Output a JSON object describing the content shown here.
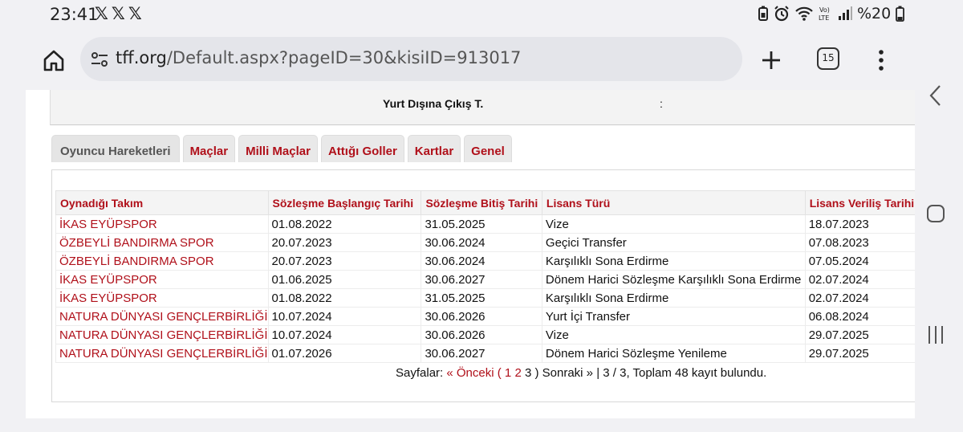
{
  "status_bar": {
    "time": "23:41",
    "notification_icons": [
      "x-icon",
      "x-icon",
      "x-icon"
    ],
    "battery_percent": "%20"
  },
  "browser": {
    "url_domain": "tff.org",
    "url_path": "/Default.aspx?pageID=30&kisiID=913017",
    "tab_count": "15"
  },
  "info": {
    "label": "Yurt Dışına Çıkış T.",
    "colon": ":"
  },
  "tabs": [
    {
      "label": "Oyuncu Hareketleri",
      "active": true
    },
    {
      "label": "Maçlar"
    },
    {
      "label": "Milli Maçlar"
    },
    {
      "label": "Attığı Goller"
    },
    {
      "label": "Kartlar"
    },
    {
      "label": "Genel"
    }
  ],
  "table": {
    "headers": [
      "Oynadığı Takım",
      "Sözleşme Başlangıç Tarihi",
      "Sözleşme Bitiş Tarihi",
      "Lisans Türü",
      "Lisans Veriliş Tarihi"
    ],
    "rows": [
      [
        "İKAS EYÜPSPOR",
        "01.08.2022",
        "31.05.2025",
        "Vize",
        "18.07.2023"
      ],
      [
        "ÖZBEYLİ BANDIRMA SPOR",
        "20.07.2023",
        "30.06.2024",
        "Geçici Transfer",
        "07.08.2023"
      ],
      [
        "ÖZBEYLİ BANDIRMA SPOR",
        "20.07.2023",
        "30.06.2024",
        "Karşılıklı Sona Erdirme",
        "07.05.2024"
      ],
      [
        "İKAS EYÜPSPOR",
        "01.06.2025",
        "30.06.2027",
        "Dönem Harici Sözleşme Karşılıklı Sona Erdirme",
        "02.07.2024"
      ],
      [
        "İKAS EYÜPSPOR",
        "01.08.2022",
        "31.05.2025",
        "Karşılıklı Sona Erdirme",
        "02.07.2024"
      ],
      [
        "NATURA DÜNYASI GENÇLERBİRLİĞİ",
        "10.07.2024",
        "30.06.2026",
        "Yurt İçi Transfer",
        "06.08.2024"
      ],
      [
        "NATURA DÜNYASI GENÇLERBİRLİĞİ",
        "10.07.2024",
        "30.06.2026",
        "Vize",
        "29.07.2025"
      ],
      [
        "NATURA DÜNYASI GENÇLERBİRLİĞİ",
        "01.07.2026",
        "30.06.2027",
        "Dönem Harici Sözleşme Yenileme",
        "29.07.2025"
      ]
    ]
  },
  "pager": {
    "label": "Sayfalar:",
    "prev": "« Önceki",
    "open_paren": "(",
    "page1": "1",
    "page2": "2",
    "current": "3",
    "close_paren": ")",
    "next": "Sonraki »",
    "summary": "| 3 / 3, Toplam 48 kayıt bulundu."
  },
  "colors": {
    "accent_red": "#b0101a",
    "chrome_bg": "#f1f1f4"
  }
}
